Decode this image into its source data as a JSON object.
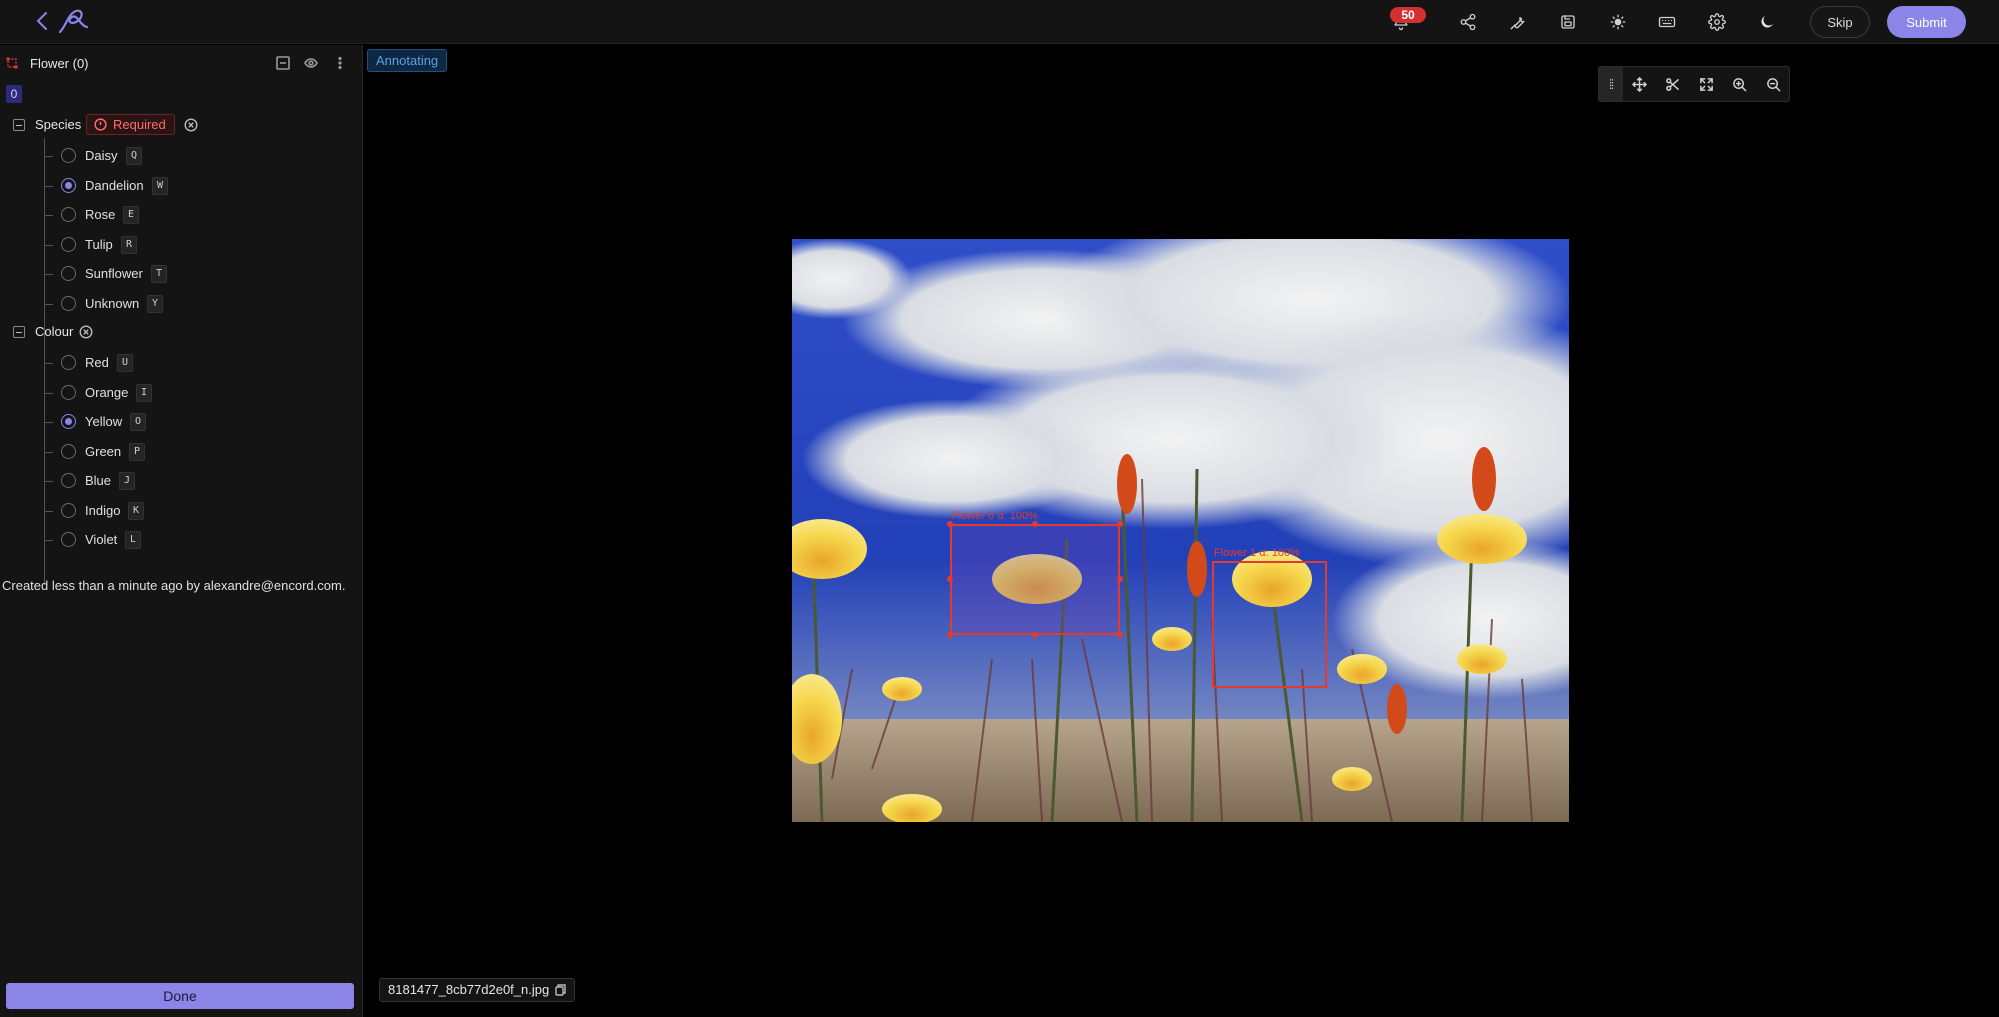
{
  "topbar": {
    "notification_count": "50",
    "skip_label": "Skip",
    "submit_label": "Submit",
    "icons": [
      "notification-icon",
      "share-icon",
      "tools-icon",
      "save-icon",
      "brightness-icon",
      "keyboard-icon",
      "settings-icon",
      "dark-mode-icon"
    ]
  },
  "sidebar": {
    "object_title": "Flower (0)",
    "object_index": "0",
    "species": {
      "title": "Species",
      "required_label": "Required",
      "options": [
        {
          "label": "Daisy",
          "key": "Q",
          "selected": false
        },
        {
          "label": "Dandelion",
          "key": "W",
          "selected": true
        },
        {
          "label": "Rose",
          "key": "E",
          "selected": false
        },
        {
          "label": "Tulip",
          "key": "R",
          "selected": false
        },
        {
          "label": "Sunflower",
          "key": "T",
          "selected": false
        },
        {
          "label": "Unknown",
          "key": "Y",
          "selected": false
        }
      ]
    },
    "colour": {
      "title": "Colour",
      "options": [
        {
          "label": "Red",
          "key": "U",
          "selected": false
        },
        {
          "label": "Orange",
          "key": "I",
          "selected": false
        },
        {
          "label": "Yellow",
          "key": "O",
          "selected": true
        },
        {
          "label": "Green",
          "key": "P",
          "selected": false
        },
        {
          "label": "Blue",
          "key": "J",
          "selected": false
        },
        {
          "label": "Indigo",
          "key": "K",
          "selected": false
        },
        {
          "label": "Violet",
          "key": "L",
          "selected": false
        }
      ]
    },
    "created_text": "Created less than a minute ago by alexandre@encord.com.",
    "done_label": "Done"
  },
  "canvas": {
    "status": "Annotating",
    "labels": [
      {
        "text": "Flower 0 α: 100%"
      },
      {
        "text": "Flower 1 α: 100%"
      }
    ],
    "filename": "8181477_8cb77d2e0f_n.jpg"
  },
  "colors": {
    "accent": "#8b85e8",
    "bbox": "#e23b2e",
    "required": "#ff6b6b",
    "status_blue": "#5aa0e6"
  }
}
